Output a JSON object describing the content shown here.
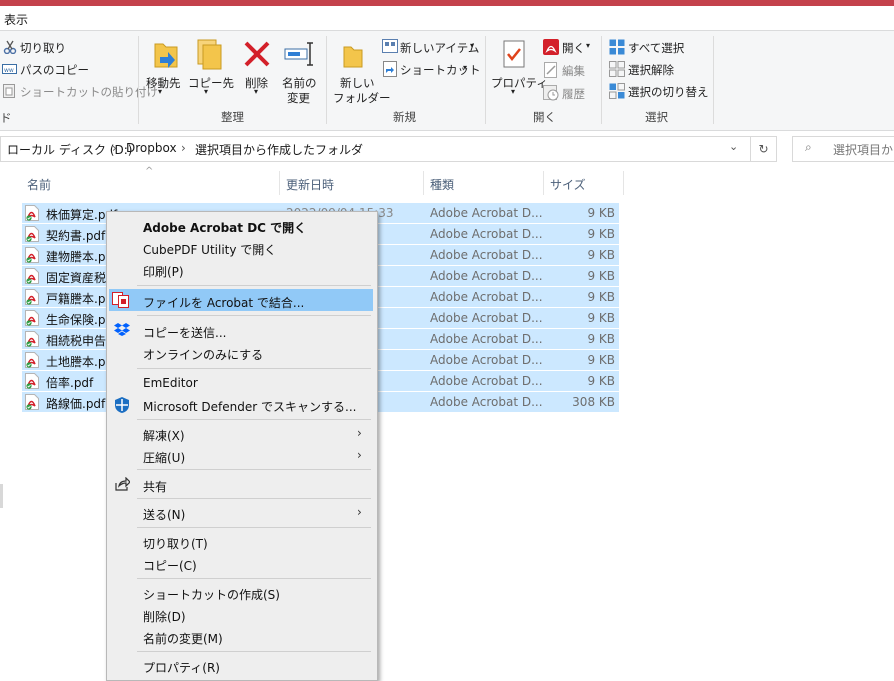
{
  "ribbon": {
    "tab": "表示",
    "clipboard": {
      "cut": "切り取り",
      "copy_path": "パスのコピー",
      "paste_shortcut": "ショートカットの貼り付け",
      "edge_label": "ド"
    },
    "organize": {
      "move_to": "移動先",
      "copy_to": "コピー先",
      "delete": "削除",
      "rename_1": "名前の",
      "rename_2": "変更",
      "group": "整理"
    },
    "new": {
      "new_folder_1": "新しい",
      "new_folder_2": "フォルダー",
      "new_item": "新しいアイテム",
      "shortcut": "ショートカット",
      "group": "新規"
    },
    "open": {
      "properties": "プロパティ",
      "open": "開く",
      "edit": "編集",
      "history": "履歴",
      "group": "開く"
    },
    "select": {
      "select_all": "すべて選択",
      "select_none": "選択解除",
      "invert": "選択の切り替え",
      "group": "選択"
    }
  },
  "address": {
    "crumbs": [
      "ローカル ディスク (D:)",
      "Dropbox",
      "選択項目から作成したフォルダ"
    ],
    "search_placeholder": "選択項目か"
  },
  "columns": {
    "name": "名前",
    "date": "更新日時",
    "type": "種類",
    "size": "サイズ"
  },
  "files": [
    {
      "name": "株価算定.pdf",
      "date": "2022/09/04 15:33",
      "type": "Adobe Acrobat D...",
      "size": "9 KB"
    },
    {
      "name": "契約書.pdf",
      "type": "Adobe Acrobat D...",
      "size": "9 KB"
    },
    {
      "name": "建物謄本.p",
      "type": "Adobe Acrobat D...",
      "size": "9 KB"
    },
    {
      "name": "固定資産税",
      "type": "Adobe Acrobat D...",
      "size": "9 KB"
    },
    {
      "name": "戸籍謄本.p",
      "type": "Adobe Acrobat D...",
      "size": "9 KB"
    },
    {
      "name": "生命保険.p",
      "type": "Adobe Acrobat D...",
      "size": "9 KB"
    },
    {
      "name": "相続税申告",
      "type": "Adobe Acrobat D...",
      "size": "9 KB"
    },
    {
      "name": "土地謄本.p",
      "type": "Adobe Acrobat D...",
      "size": "9 KB"
    },
    {
      "name": "倍率.pdf",
      "type": "Adobe Acrobat D...",
      "size": "9 KB"
    },
    {
      "name": "路線価.pdf",
      "type": "Adobe Acrobat D...",
      "size": "308 KB"
    }
  ],
  "context_menu": {
    "open_acrobat": "Adobe Acrobat DC で開く",
    "open_cubepdf": "CubePDF Utility で開く",
    "print": "印刷(P)",
    "combine": "ファイルを Acrobat で結合...",
    "send_copy": "コピーを送信...",
    "online_only": "オンラインのみにする",
    "emeditor": "EmEditor",
    "defender": "Microsoft Defender でスキャンする...",
    "extract": "解凍(X)",
    "compress": "圧縮(U)",
    "share": "共有",
    "send_to": "送る(N)",
    "cut": "切り取り(T)",
    "copy": "コピー(C)",
    "create_shortcut": "ショートカットの作成(S)",
    "delete": "削除(D)",
    "rename": "名前の変更(M)",
    "properties": "プロパティ(R)"
  }
}
